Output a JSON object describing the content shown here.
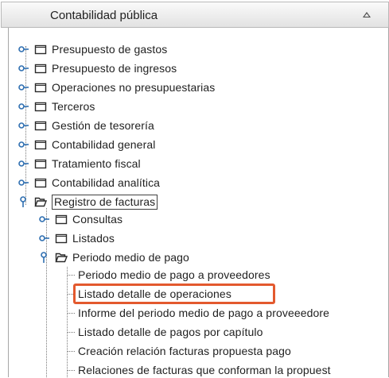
{
  "header": {
    "title": "Contabilidad pública",
    "collapse_icon": "chevron-up-icon"
  },
  "tree": {
    "root_items": [
      {
        "label": "Presupuesto de gastos"
      },
      {
        "label": "Presupuesto de ingresos"
      },
      {
        "label": "Operaciones no presupuestarias"
      },
      {
        "label": "Terceros"
      },
      {
        "label": "Gestión de tesorería"
      },
      {
        "label": "Contabilidad general"
      },
      {
        "label": "Tratamiento fiscal"
      },
      {
        "label": "Contabilidad analítica"
      },
      {
        "label": "Registro de facturas",
        "expanded": true,
        "selected": true
      }
    ],
    "registro_children": [
      {
        "label": "Consultas"
      },
      {
        "label": "Listados"
      },
      {
        "label": "Periodo medio de pago",
        "expanded": true
      }
    ],
    "periodo_leaves": [
      {
        "label": "Periodo medio de pago a proveedores"
      },
      {
        "label": "Listado detalle de operaciones",
        "highlighted": true
      },
      {
        "label": "Informe del periodo medio de pago a proveeedore"
      },
      {
        "label": "Listado detalle de pagos por capítulo"
      },
      {
        "label": "Creación relación facturas propuesta pago"
      },
      {
        "label": "Relaciones de facturas que conforman la propuest"
      }
    ]
  },
  "colors": {
    "highlight": "#e3592e",
    "handle": "#2f6fb1",
    "tree_line": "#7a7a7a"
  }
}
